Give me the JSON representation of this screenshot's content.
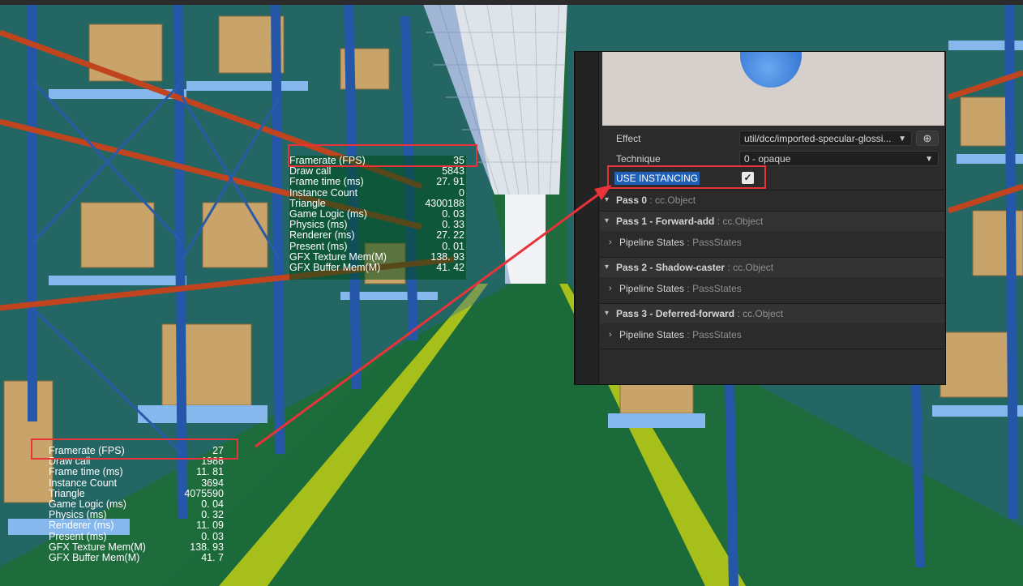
{
  "stats_before": {
    "rows": [
      {
        "label": "Framerate (FPS)",
        "value": "35"
      },
      {
        "label": "Draw call",
        "value": "5843"
      },
      {
        "label": "Frame time (ms)",
        "value": "27. 91"
      },
      {
        "label": "Instance Count",
        "value": "0"
      },
      {
        "label": "Triangle",
        "value": "4300188"
      },
      {
        "label": "Game Logic (ms)",
        "value": "0. 03"
      },
      {
        "label": "Physics (ms)",
        "value": "0. 33"
      },
      {
        "label": "Renderer (ms)",
        "value": "27. 22"
      },
      {
        "label": "Present (ms)",
        "value": "0. 01"
      },
      {
        "label": "GFX Texture Mem(M)",
        "value": "138. 93"
      },
      {
        "label": "GFX Buffer Mem(M)",
        "value": "41. 42"
      }
    ]
  },
  "stats_after": {
    "rows": [
      {
        "label": "Framerate (FPS)",
        "value": "27"
      },
      {
        "label": "Draw call",
        "value": "1988"
      },
      {
        "label": "Frame time (ms)",
        "value": "11. 81"
      },
      {
        "label": "Instance Count",
        "value": "3694"
      },
      {
        "label": "Triangle",
        "value": "4075590"
      },
      {
        "label": "Game Logic (ms)",
        "value": "0. 04"
      },
      {
        "label": "Physics (ms)",
        "value": "0. 32"
      },
      {
        "label": "Renderer (ms)",
        "value": "11. 09"
      },
      {
        "label": "Present (ms)",
        "value": "0. 03"
      },
      {
        "label": "GFX Texture Mem(M)",
        "value": "138. 93"
      },
      {
        "label": "GFX Buffer Mem(M)",
        "value": "41. 7"
      }
    ]
  },
  "inspector": {
    "effect_label": "Effect",
    "effect_value": "util/dcc/imported-specular-glossi...",
    "technique_label": "Technique",
    "technique_value": "0 - opaque",
    "use_instancing_label": "USE INSTANCING",
    "use_instancing_checked": true,
    "pass0": {
      "title": "Pass 0",
      "type": " : cc.Object"
    },
    "pass1": {
      "title": "Pass 1 - Forward-add",
      "type": " : cc.Object"
    },
    "pass2": {
      "title": "Pass 2 - Shadow-caster",
      "type": " : cc.Object"
    },
    "pass3": {
      "title": "Pass 3 - Deferred-forward",
      "type": " : cc.Object"
    },
    "pipeline_label": "Pipeline States",
    "pipeline_type": " : PassStates"
  },
  "colors": {
    "highlight": "#e8333a",
    "selection": "#1f5fb8",
    "floor": "#1e6b3c",
    "rack": "#2a5aa8"
  },
  "icons": {
    "dropdown": "chevron-down-icon",
    "locate": "crosshair-icon",
    "check": "checkmark-icon",
    "expand": "chevron-right-icon"
  }
}
